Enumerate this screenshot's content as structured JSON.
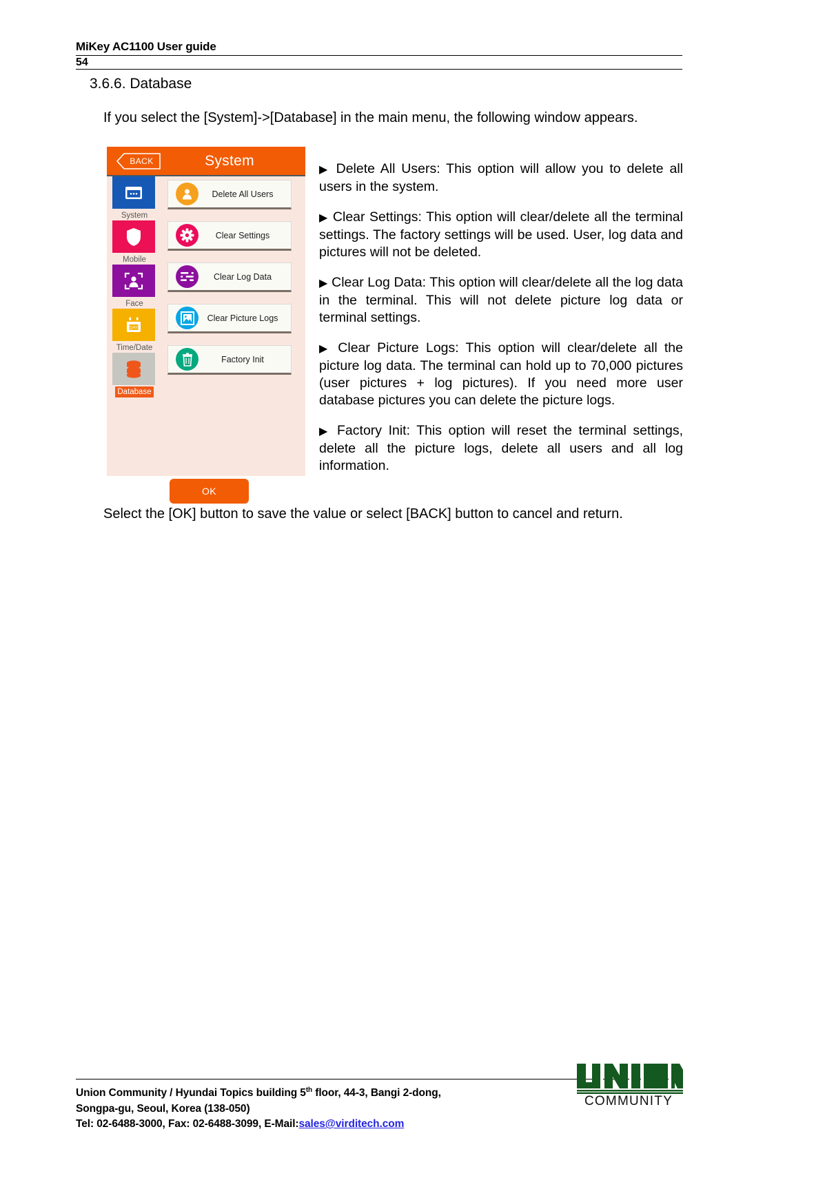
{
  "header": {
    "title": "MiKey AC1100 User guide",
    "page_number": "54"
  },
  "section": {
    "title": "3.6.6. Database",
    "intro": "If you select the [System]->[Database] in the main menu, the following window appears.",
    "closing": "Select the [OK] button to save the value or select [BACK] button to cancel and return."
  },
  "device": {
    "back_label": "BACK",
    "screen_title": "System",
    "ok_label": "OK",
    "sidebar": [
      {
        "label": "System",
        "icon": "system-icon",
        "color": "#1559b5",
        "active": false
      },
      {
        "label": "Mobile",
        "icon": "shield-icon",
        "color": "#ec1055",
        "active": false
      },
      {
        "label": "Face",
        "icon": "face-icon",
        "color": "#8c0f9e",
        "active": false
      },
      {
        "label": "Time/Date",
        "icon": "calendar-icon",
        "color": "#f5b000",
        "active": false
      },
      {
        "label": "Database",
        "icon": "database-icon",
        "color": "#c6c6c1",
        "active": true
      }
    ],
    "menu": [
      {
        "label": "Delete All Users",
        "icon": "user-icon",
        "color": "#f5a01e"
      },
      {
        "label": "Clear Settings",
        "icon": "gear-icon",
        "color": "#eb0c5c"
      },
      {
        "label": "Clear Log Data",
        "icon": "log-icon",
        "color": "#8c0f9e"
      },
      {
        "label": "Clear Picture Logs",
        "icon": "picture-icon",
        "color": "#08a6e4"
      },
      {
        "label": "Factory Init",
        "icon": "trash-icon",
        "color": "#06a97f"
      }
    ]
  },
  "bullets": [
    {
      "marker": "▶",
      "text": "Delete All Users: This option will allow you to delete all users in the system."
    },
    {
      "marker": "▶",
      "text": "Clear Settings: This option will clear/delete all the terminal settings. The factory settings will be used. User, log data and pictures will not be deleted."
    },
    {
      "marker": "▶",
      "text": "Clear Log Data: This option will clear/delete all the log data in the terminal. This will not delete picture log data or terminal settings."
    },
    {
      "marker": "▶",
      "text": "Clear Picture Logs: This option will clear/delete all the picture log data. The terminal can hold up to 70,000 pictures (user pictures + log pictures). If you need more user database pictures you can delete the picture logs."
    },
    {
      "marker": "▶",
      "text": "Factory Init: This option will reset the terminal settings, delete all the picture logs, delete all users and all log information."
    }
  ],
  "footer": {
    "line1_a": "Union Community / Hyundai Topics building 5",
    "line1_sup": "th",
    "line1_b": " floor, 44-3, Bangi 2-dong,",
    "line2": "Songpa-gu, Seoul, Korea (138-050)",
    "line3_a": "Tel: 02-6488-3000, Fax: 02-6488-3099, E-Mail:",
    "line3_link": "sales@virditech.com",
    "logo_word": "COMMUNITY",
    "logo_mark": "UNION",
    "logo_color": "#14591f"
  }
}
